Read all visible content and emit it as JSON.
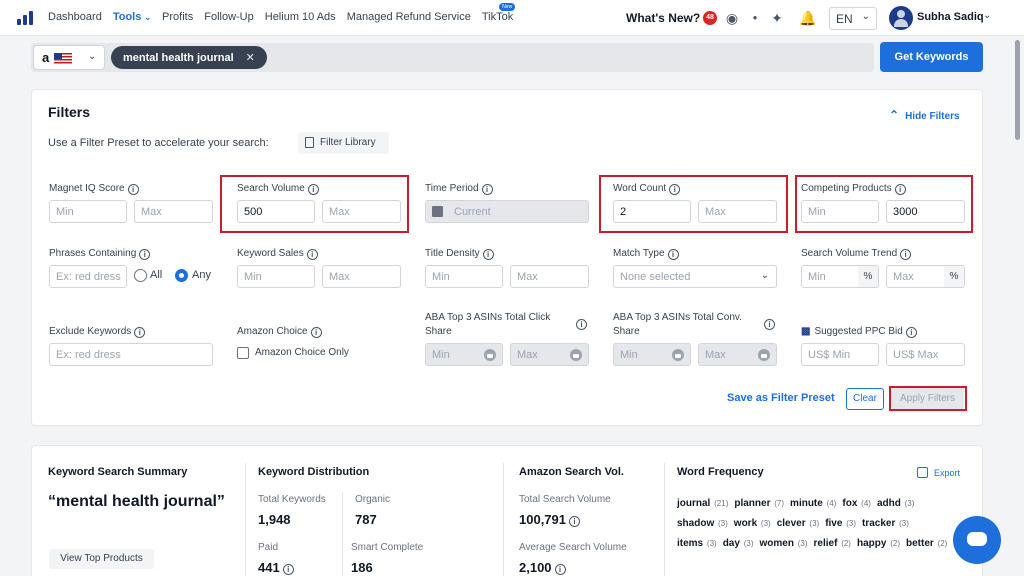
{
  "nav": {
    "items": [
      {
        "label": "Dashboard"
      },
      {
        "label": "Tools"
      },
      {
        "label": "Profits"
      },
      {
        "label": "Follow-Up"
      },
      {
        "label": "Helium 10 Ads"
      },
      {
        "label": "Managed Refund Service"
      },
      {
        "label": "TikTok",
        "badge": "New"
      }
    ],
    "whats_new": "What's New?",
    "notif_count": "48",
    "language": "EN",
    "user_name": "Subha Sadiq"
  },
  "search": {
    "keyword_chip": "mental health journal",
    "get_keywords": "Get Keywords"
  },
  "filters": {
    "title": "Filters",
    "hide_filters": "Hide Filters",
    "preset_text": "Use a Filter Preset to accelerate your search:",
    "filter_library": "Filter Library",
    "magnet_iq": {
      "label": "Magnet IQ Score",
      "min": "Min",
      "max": "Max"
    },
    "search_volume": {
      "label": "Search Volume",
      "min": "500",
      "max": "Max"
    },
    "time_period": {
      "label": "Time Period",
      "value": "Current"
    },
    "word_count": {
      "label": "Word Count",
      "min": "2",
      "max": "Max"
    },
    "competing_products": {
      "label": "Competing Products",
      "min": "Min",
      "max": "3000"
    },
    "phrases_containing": {
      "label": "Phrases Containing",
      "placeholder": "Ex: red dress",
      "all": "All",
      "any": "Any"
    },
    "keyword_sales": {
      "label": "Keyword Sales",
      "min": "Min",
      "max": "Max"
    },
    "title_density": {
      "label": "Title Density",
      "min": "Min",
      "max": "Max"
    },
    "match_type": {
      "label": "Match Type",
      "value": "None selected"
    },
    "sv_trend": {
      "label": "Search Volume Trend",
      "min": "Min",
      "max": "Max",
      "unit": "%"
    },
    "exclude_keywords": {
      "label": "Exclude Keywords",
      "placeholder": "Ex: red dress"
    },
    "amazon_choice": {
      "label": "Amazon Choice",
      "checkbox": "Amazon Choice Only"
    },
    "aba_click": {
      "label1": "ABA Top 3 ASINs Total Click",
      "label2": "Share",
      "min": "Min",
      "max": "Max"
    },
    "aba_conv": {
      "label1": "ABA Top 3 ASINs Total Conv.",
      "label2": "Share",
      "min": "Min",
      "max": "Max"
    },
    "ppc_bid": {
      "label": "Suggested PPC Bid",
      "min": "US$  Min",
      "max": "US$  Max"
    },
    "save_preset": "Save as Filter Preset",
    "clear": "Clear",
    "apply": "Apply Filters"
  },
  "summary": {
    "kss_title": "Keyword Search Summary",
    "keyword": "“mental health journal”",
    "view_top": "View Top Products",
    "kd_title": "Keyword Distribution",
    "total_keywords_lbl": "Total Keywords",
    "total_keywords": "1,948",
    "organic_lbl": "Organic",
    "organic": "787",
    "paid_lbl": "Paid",
    "paid": "441",
    "smart_lbl": "Smart Complete",
    "smart": "186",
    "asv_title": "Amazon Search Vol.",
    "tsv_lbl": "Total Search Volume",
    "tsv": "100,791",
    "avg_lbl": "Average Search Volume",
    "avg": "2,100",
    "wf_title": "Word Frequency",
    "export": "Export",
    "words": [
      {
        "w": "journal",
        "c": "(21)"
      },
      {
        "w": "planner",
        "c": "(7)"
      },
      {
        "w": "minute",
        "c": "(4)"
      },
      {
        "w": "fox",
        "c": "(4)"
      },
      {
        "w": "adhd",
        "c": "(3)"
      },
      {
        "w": "shadow",
        "c": "(3)"
      },
      {
        "w": "work",
        "c": "(3)"
      },
      {
        "w": "clever",
        "c": "(3)"
      },
      {
        "w": "five",
        "c": "(3)"
      },
      {
        "w": "tracker",
        "c": "(3)"
      },
      {
        "w": "items",
        "c": "(3)"
      },
      {
        "w": "day",
        "c": "(3)"
      },
      {
        "w": "women",
        "c": "(3)"
      },
      {
        "w": "relief",
        "c": "(2)"
      },
      {
        "w": "happy",
        "c": "(2)"
      },
      {
        "w": "better",
        "c": "(2)"
      }
    ]
  }
}
